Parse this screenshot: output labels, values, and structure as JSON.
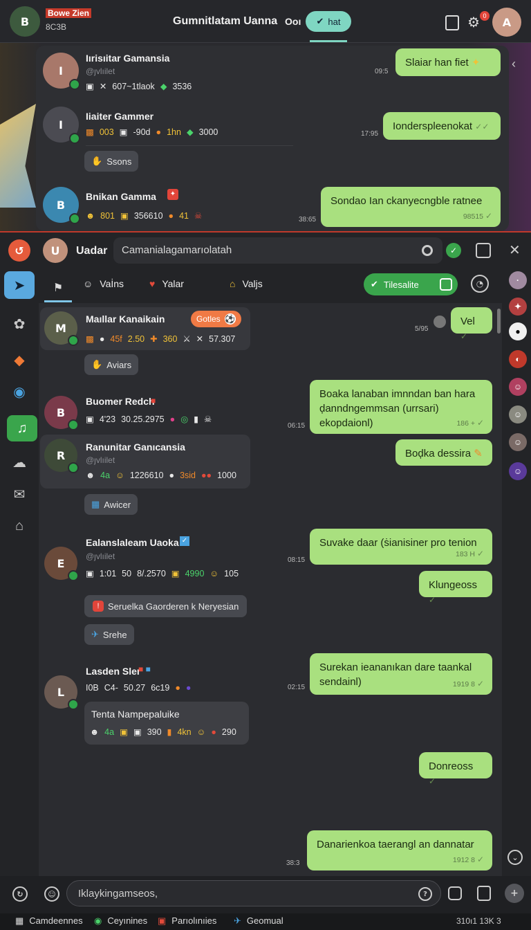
{
  "topbar": {
    "brand": "Bowe Zien",
    "sub": "8C3B",
    "title": "Gumnitlatam Uanna",
    "badge_num": "Ooı",
    "pill": "hat",
    "notif": "0"
  },
  "top_chats": [
    {
      "name": "Iırisıitar Gamansia",
      "handle": "@ȷvlıilet",
      "stats": [
        "607~1tlaok",
        "3536"
      ],
      "msg": "Slaiar han fiet",
      "time": "09:5"
    },
    {
      "name": "Iiaiter Gammer",
      "stats": [
        "003",
        "-90d",
        "1hn",
        "3000"
      ],
      "chip": "Ssons",
      "msg": "Iondersplеenokat",
      "time": "17:95"
    },
    {
      "name": "Bnikan Gamma",
      "stats": [
        "801",
        "356610",
        "41"
      ],
      "msg": "Sondao Ian ckanyecngble ratnee",
      "meta": "98515",
      "time": "38:65"
    }
  ],
  "chat_header": {
    "name": "Uadar",
    "search": "Camanialagamarıolatah"
  },
  "tabs": [
    {
      "label": "Vaİns"
    },
    {
      "label": "Yalar"
    },
    {
      "label": "Valjs"
    }
  ],
  "toggle": "Tilesalite",
  "messages": [
    {
      "name": "Maıllar Kanaikain",
      "tag": "Gotles",
      "stats": [
        "45f",
        "2.50",
        "360",
        "57.307"
      ],
      "chip": "Aviars",
      "reply": "Vel",
      "time": "5/95"
    },
    {
      "name": "Buomer Redch",
      "stats": [
        "4'23",
        "30.25.2975"
      ],
      "reply": "Boaka lanaban imnndan ban hara ḑanndngemmsan (urrsari) ekopdaionl)",
      "meta": "186 +",
      "time": "06:15"
    },
    {
      "name": "Ranunitar Ganıcansia",
      "handle": "@ȷvlıilet",
      "stats": [
        "4a",
        "1226610",
        "3sid",
        "1000"
      ],
      "chip": "Awicer",
      "reply": "Boḑka dessira"
    },
    {
      "name": "Ealanslaleam Uaoka",
      "handle": "@ȷvlıilet",
      "stats": [
        "1:01",
        "50",
        "8/.2570",
        "4990",
        "105"
      ],
      "chip": "Seruelka Gaorderen k Neryesian",
      "chip2": "Srehe",
      "reply": "Suvake daar (ṡianisiner pro tenion",
      "meta": "183 H",
      "reply2": "Klungeoss",
      "time": "08:15"
    },
    {
      "name": "Lasden Sler",
      "stats": [
        "I0B",
        "C4-",
        "50.27",
        "6c19"
      ],
      "chip": "Tenta Nampepaluike",
      "chip_stats": [
        "4a",
        "390",
        "4kn",
        "290"
      ],
      "reply": "Surekan ieananıkan dare taankal sendainl)",
      "meta": "1919 8",
      "time": "02:15"
    }
  ],
  "late": [
    {
      "text": "Donreoss"
    },
    {
      "text": "Danarienkoa taerangl an dannatar",
      "meta": "1912 8",
      "time": "38:3"
    }
  ],
  "composer": {
    "placeholder": "Iklaykingamseos,"
  },
  "footer": [
    {
      "label": "Camdeennes"
    },
    {
      "label": "Ceyınines"
    },
    {
      "label": "Parıolınıies"
    },
    {
      "label": "Geomual"
    }
  ],
  "footer_right": "310ı1 13K 3"
}
